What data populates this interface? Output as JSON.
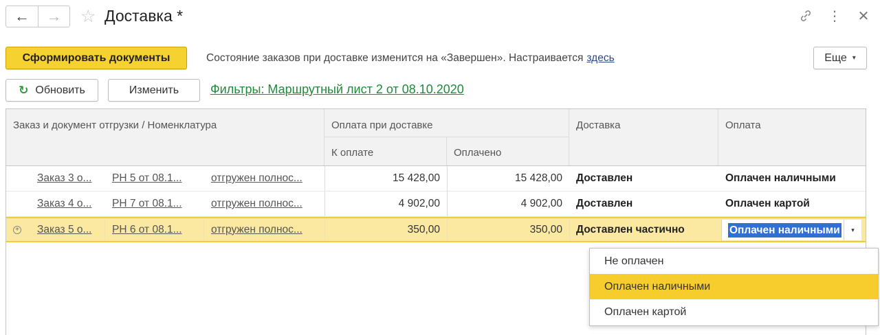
{
  "window": {
    "title": "Доставка *",
    "nav_back_icon": "←",
    "nav_forward_icon": "→",
    "favorite_icon": "☆",
    "link_icon": "🔗",
    "menu_icon": "⋮",
    "close_icon": "✕"
  },
  "toolbar": {
    "generate_label": "Сформировать документы",
    "info_text": "Состояние заказов при доставке изменится на «Завершен». Настраивается",
    "info_link": "здесь",
    "more_label": "Еще",
    "more_caret": "▾"
  },
  "actions": {
    "refresh_icon": "↻",
    "refresh_label": "Обновить",
    "edit_label": "Изменить",
    "filter_link": "Фильтры: Маршрутный лист 2 от 08.10.2020"
  },
  "table": {
    "headers": {
      "order": "Заказ и документ отгрузки / Номенклатура",
      "payment_group": "Оплата при доставке",
      "to_pay": "К оплате",
      "paid": "Оплачено",
      "delivery": "Доставка",
      "payment": "Оплата"
    },
    "rows": [
      {
        "order": "Заказ 3 о...",
        "doc": "РН 5 от 08.1...",
        "status": "отгружен полнос...",
        "to_pay": "15 428,00",
        "paid": "15 428,00",
        "delivery": "Доставлен",
        "payment": "Оплачен наличными"
      },
      {
        "order": "Заказ 4 о...",
        "doc": "РН 7 от 08.1...",
        "status": "отгружен полнос...",
        "to_pay": "4 902,00",
        "paid": "4 902,00",
        "delivery": "Доставлен",
        "payment": "Оплачен картой"
      },
      {
        "expand_icon": "+",
        "order": "Заказ 5 о...",
        "doc": "РН 6 от 08.1...",
        "status": "отгружен полнос...",
        "to_pay": "350,00",
        "paid": "350,00",
        "delivery": "Доставлен частично",
        "payment": "Оплачен наличными",
        "dropdown_caret": "▾"
      }
    ]
  },
  "dropdown": {
    "options": [
      "Не оплачен",
      "Оплачен наличными",
      "Оплачен картой"
    ],
    "selected": "Оплачен наличными"
  },
  "colors": {
    "primary_button": "#f6d231",
    "selected_row": "#fbe9a2",
    "selection_highlight": "#2f6fd6",
    "filter_link": "#1f8a3a",
    "dropdown_active": "#f6cd2d"
  }
}
